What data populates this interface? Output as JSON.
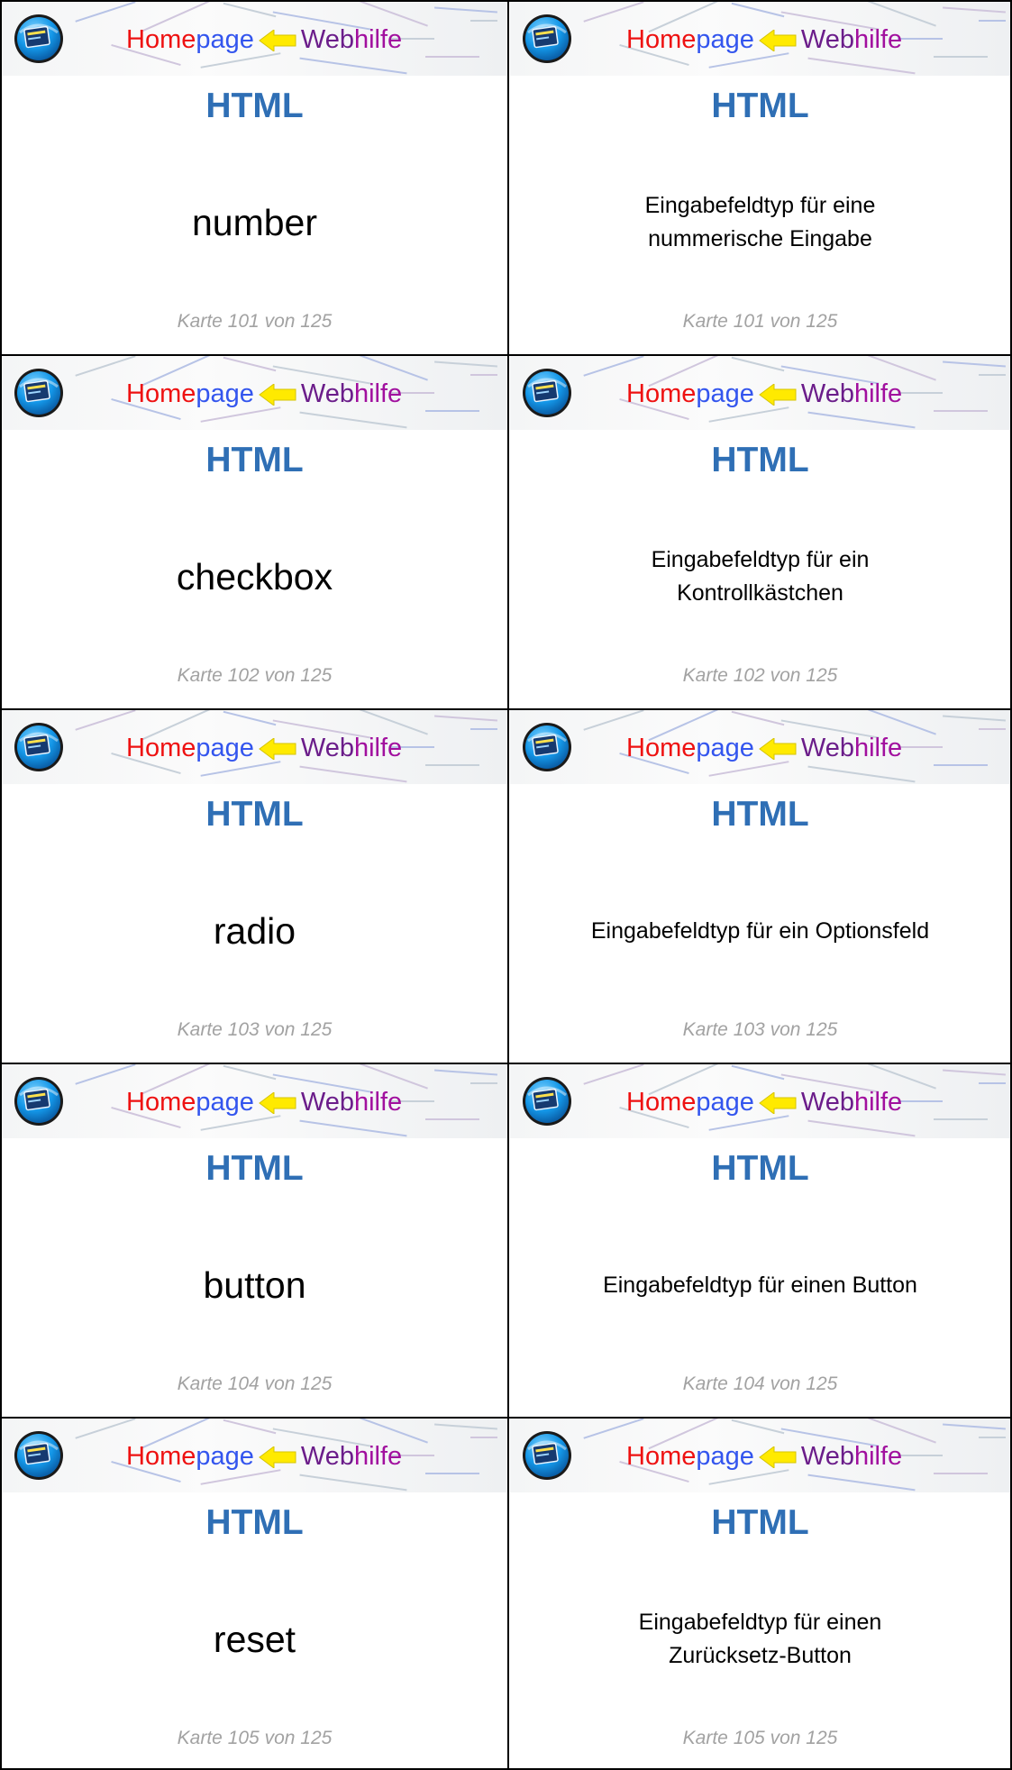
{
  "brand": {
    "part1": "Home",
    "part2": "page",
    "part3": "Web",
    "part4": "hilfe"
  },
  "cards": [
    {
      "title": "HTML",
      "text": "number",
      "counter": "Karte 101 von 125"
    },
    {
      "title": "HTML",
      "text": "Eingabefeldtyp für eine\nnummerische Eingabe",
      "counter": "Karte 101 von 125"
    },
    {
      "title": "HTML",
      "text": "checkbox",
      "counter": "Karte 102 von 125"
    },
    {
      "title": "HTML",
      "text": "Eingabefeldtyp für ein\nKontrollkästchen",
      "counter": "Karte 102 von 125"
    },
    {
      "title": "HTML",
      "text": "radio",
      "counter": "Karte 103 von 125"
    },
    {
      "title": "HTML",
      "text": "Eingabefeldtyp für ein Optionsfeld",
      "counter": "Karte 103 von 125"
    },
    {
      "title": "HTML",
      "text": "button",
      "counter": "Karte 104 von 125"
    },
    {
      "title": "HTML",
      "text": "Eingabefeldtyp für einen Button",
      "counter": "Karte 104 von 125"
    },
    {
      "title": "HTML",
      "text": "reset",
      "counter": "Karte 105 von 125"
    },
    {
      "title": "HTML",
      "text": "Eingabefeldtyp für einen\nZurücksetz-Button",
      "counter": "Karte 105 von 125"
    }
  ],
  "colors": {
    "title_blue": "#2f6fb5",
    "counter_gray": "#a2a2a2",
    "brand_red": "#ee1111",
    "brand_blue": "#3355ee",
    "brand_purple": "#6b1d8a",
    "brand_magenta": "#a10f9e",
    "arrow_yellow": "#ffea00",
    "logo_blue": "#1497e8"
  },
  "icons": [
    "website-logo-icon",
    "arrow-icon"
  ]
}
